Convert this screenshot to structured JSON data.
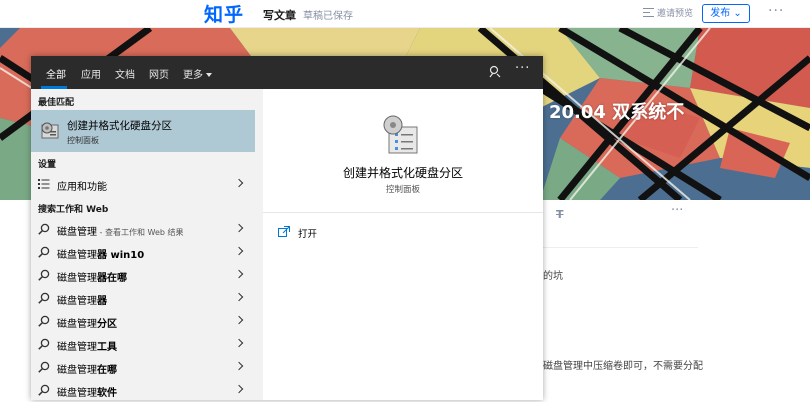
{
  "zhihu": {
    "logo": "知乎",
    "write_article": "写文章",
    "draft_status": "草稿已保存",
    "invite_preview": "邀请预览",
    "publish_label": "发布",
    "more_label": "···",
    "brand_color": "#0066ff"
  },
  "banner": {
    "title_fragment": "20.04 双系统不"
  },
  "article": {
    "toolbar_strike_icon": "strikethrough-icon",
    "toolbar_more": "···",
    "line1_fragment": "的坑",
    "line2_fragment": "磁盘管理中压缩卷即可，不需要分配"
  },
  "start_menu": {
    "tabs": [
      {
        "label": "全部",
        "active": true
      },
      {
        "label": "应用"
      },
      {
        "label": "文档"
      },
      {
        "label": "网页"
      },
      {
        "label": "更多"
      }
    ],
    "more_label": "···",
    "accent": "#0078d7",
    "best_match_header": "最佳匹配",
    "best_match": {
      "title": "创建并格式化硬盘分区",
      "subtitle": "控制面板",
      "icon": "disk-management-icon"
    },
    "settings_header": "设置",
    "settings_items": [
      {
        "label": "应用和功能",
        "icon": "apps-list-icon"
      }
    ],
    "web_header": "搜索工作和 Web",
    "web_items": [
      {
        "prefix": "磁盘管理",
        "suffix": "",
        "hint": " - 查看工作和 Web 结果"
      },
      {
        "prefix": "磁盘管理",
        "suffix": "器 win10",
        "hint": ""
      },
      {
        "prefix": "磁盘管理",
        "suffix": "器在哪",
        "hint": ""
      },
      {
        "prefix": "磁盘管理",
        "suffix": "器",
        "hint": ""
      },
      {
        "prefix": "磁盘管理",
        "suffix": "分区",
        "hint": ""
      },
      {
        "prefix": "磁盘管理",
        "suffix": "工具",
        "hint": ""
      },
      {
        "prefix": "磁盘管理",
        "suffix": "在哪",
        "hint": ""
      },
      {
        "prefix": "磁盘管理",
        "suffix": "软件",
        "hint": ""
      }
    ],
    "preview": {
      "title": "创建并格式化硬盘分区",
      "subtitle": "控制面板",
      "action_open": "打开"
    }
  }
}
